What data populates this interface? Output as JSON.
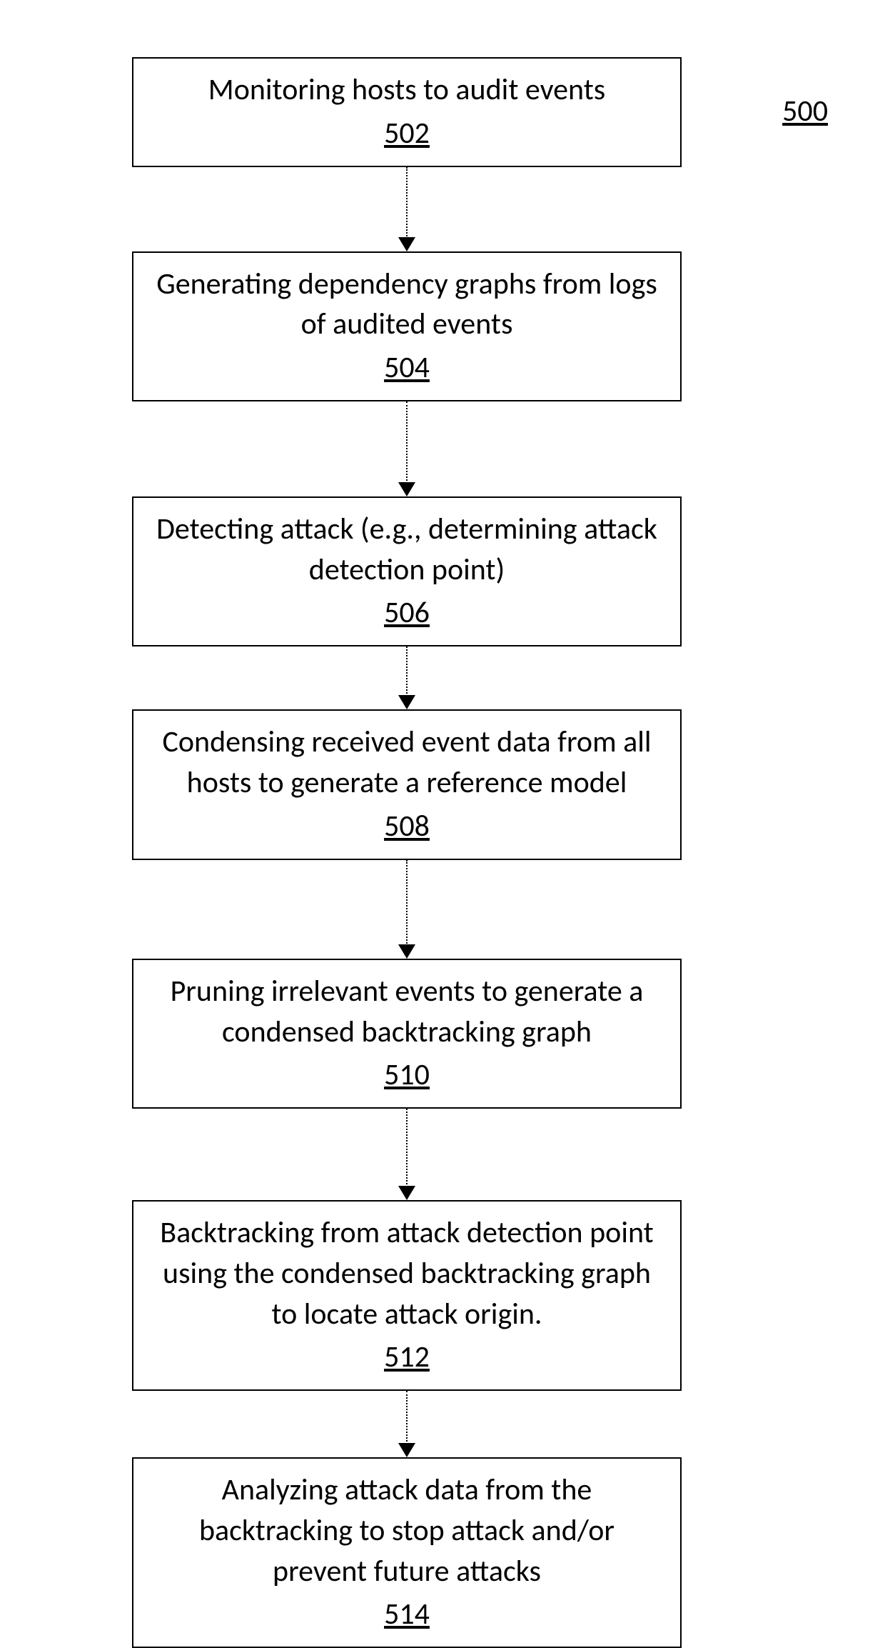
{
  "figure_ref": "500",
  "steps": [
    {
      "text": "Monitoring hosts to audit events",
      "num": "502"
    },
    {
      "text": "Generating dependency graphs from logs of audited events",
      "num": "504"
    },
    {
      "text": "Detecting attack\n(e.g., determining attack detection point)",
      "num": "506"
    },
    {
      "text": "Condensing received event data from all hosts to generate a reference model",
      "num": "508"
    },
    {
      "text": "Pruning irrelevant events to generate a condensed backtracking graph",
      "num": "510"
    },
    {
      "text": "Backtracking from attack detection point using the condensed backtracking graph to locate attack origin.",
      "num": "512"
    },
    {
      "text": "Analyzing attack data from the backtracking to stop attack and/or prevent future attacks",
      "num": "514"
    }
  ],
  "arrow_heights": [
    100,
    115,
    70,
    120,
    110,
    75,
    75
  ]
}
